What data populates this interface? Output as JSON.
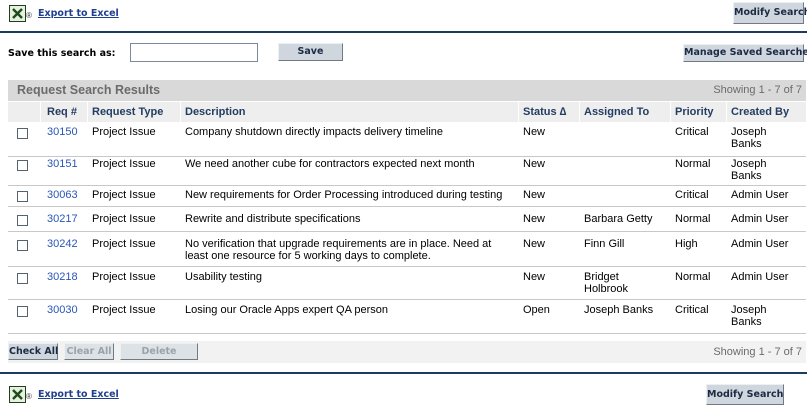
{
  "top_toolbar": {
    "export_label": "Export to Excel",
    "modify_label": "Modify Search"
  },
  "save_search": {
    "label": "Save this search as:",
    "value": "",
    "save_button": "Save",
    "manage_button": "Manage Saved Searches"
  },
  "results": {
    "title": "Request Search Results",
    "showing": "Showing 1 - 7 of 7",
    "columns": [
      "Req #",
      "Request Type",
      "Description",
      "Status ∆",
      "Assigned To",
      "Priority",
      "Created By"
    ],
    "rows": [
      {
        "req": "30150",
        "type": "Project Issue",
        "description": "Company shutdown directly impacts delivery timeline",
        "status": "New",
        "assigned": "",
        "priority": "Critical",
        "created": "Joseph Banks"
      },
      {
        "req": "30151",
        "type": "Project Issue",
        "description": "We need another cube for contractors expected next month",
        "status": "New",
        "assigned": "",
        "priority": "Normal",
        "created": "Joseph Banks"
      },
      {
        "req": "30063",
        "type": "Project Issue",
        "description": "New requirements for Order Processing introduced during testing",
        "status": "New",
        "assigned": "",
        "priority": "Critical",
        "created": "Admin User"
      },
      {
        "req": "30217",
        "type": "Project Issue",
        "description": "Rewrite and distribute specifications",
        "status": "New",
        "assigned": "Barbara Getty",
        "priority": "Normal",
        "created": "Admin User"
      },
      {
        "req": "30242",
        "type": "Project Issue",
        "description": "No verification that upgrade requirements are in place. Need at least one resource for 5 working days to complete.",
        "status": "New",
        "assigned": "Finn Gill",
        "priority": "High",
        "created": "Admin User"
      },
      {
        "req": "30218",
        "type": "Project Issue",
        "description": "Usability testing",
        "status": "New",
        "assigned": "Bridget Holbrook",
        "priority": "Normal",
        "created": "Admin User"
      },
      {
        "req": "30030",
        "type": "Project Issue",
        "description": "Losing our Oracle Apps expert QA person",
        "status": "Open",
        "assigned": "Joseph Banks",
        "priority": "Critical",
        "created": "Joseph Banks"
      }
    ]
  },
  "actions": {
    "check_all": "Check All",
    "clear_all": "Clear All",
    "delete": "Delete",
    "showing": "Showing 1 - 7 of 7"
  },
  "bottom_toolbar": {
    "export_label": "Export to Excel",
    "modify_label": "Modify Search"
  }
}
